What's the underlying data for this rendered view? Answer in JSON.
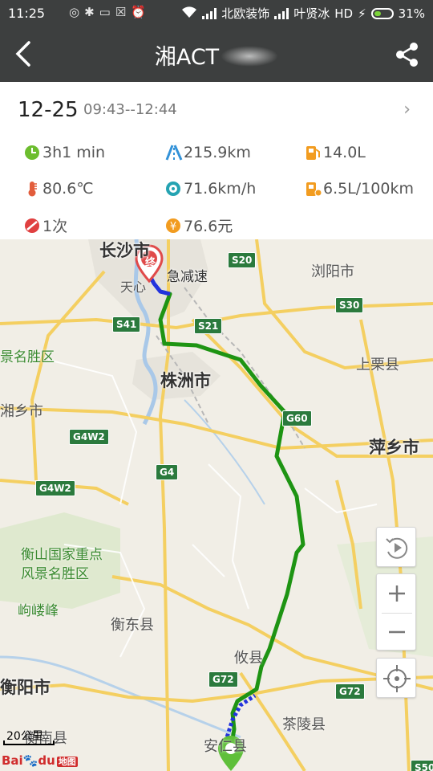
{
  "status_bar": {
    "time": "11:25",
    "carrier1": "北欧装饰",
    "carrier2": "叶贤冰",
    "network": "HD",
    "battery": "31%"
  },
  "header": {
    "title": "湘ACT"
  },
  "trip": {
    "date": "12-25",
    "time_range": "09:43--12:44",
    "stats": {
      "duration": "3h1 min",
      "distance": "215.9km",
      "fuel": "14.0L",
      "temperature": "80.6℃",
      "avg_speed": "71.6km/h",
      "fuel_rate": "6.5L/100km",
      "hard_brake": "1次",
      "cost": "76.6元"
    }
  },
  "map": {
    "end_label": "终",
    "event_label": "急减速",
    "scale": "20公里",
    "logo": {
      "bai": "Bai",
      "du": "du",
      "map": "地图"
    },
    "cities": [
      "长沙市",
      "株洲市",
      "萍乡市",
      "衡阳市"
    ],
    "towns": [
      "浏阳市",
      "上栗县",
      "湘乡市",
      "衡东县",
      "攸县",
      "茶陵县",
      "安仁县",
      "衡南县",
      "天心"
    ],
    "scenic": [
      "景名胜区",
      "衡山国家重点",
      "风景名胜区",
      "岣嵝峰"
    ],
    "shields": [
      "S20",
      "S30",
      "S41",
      "S21",
      "G60",
      "G4W2",
      "G4",
      "G4W2",
      "G72",
      "G72",
      "S50"
    ],
    "colors": {
      "route": "#1e9413",
      "route_start": "#2233dd",
      "end_pin": "#e04a4a",
      "start_pin": "#5fbf3a"
    }
  }
}
